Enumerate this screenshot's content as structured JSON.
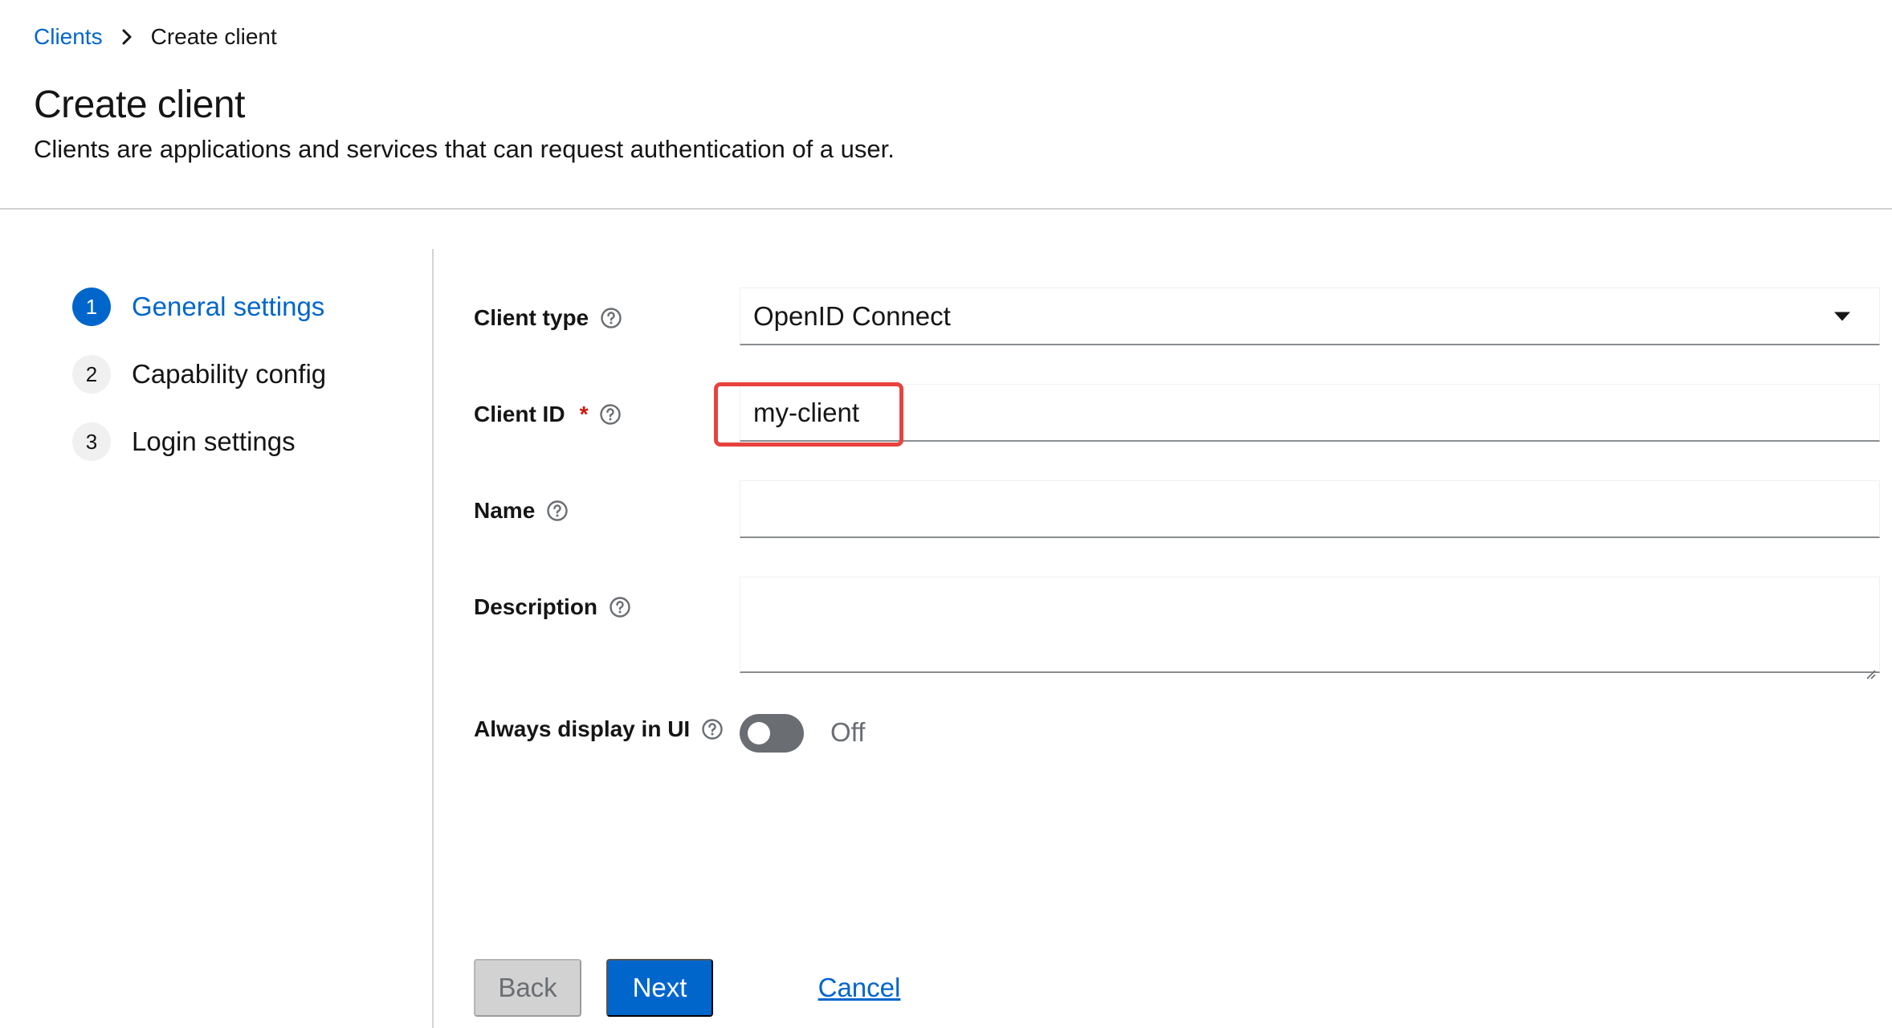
{
  "breadcrumb": {
    "parent": "Clients",
    "current": "Create client"
  },
  "header": {
    "title": "Create client",
    "description": "Clients are applications and services that can request authentication of a user."
  },
  "wizard": {
    "steps": [
      {
        "number": "1",
        "label": "General settings",
        "active": true
      },
      {
        "number": "2",
        "label": "Capability config",
        "active": false
      },
      {
        "number": "3",
        "label": "Login settings",
        "active": false
      }
    ]
  },
  "form": {
    "client_type": {
      "label": "Client type",
      "value": "OpenID Connect"
    },
    "client_id": {
      "label": "Client ID",
      "required_mark": "*",
      "value": "my-client"
    },
    "name": {
      "label": "Name",
      "value": ""
    },
    "description": {
      "label": "Description",
      "value": ""
    },
    "always_display": {
      "label": "Always display in UI",
      "state": "Off"
    }
  },
  "footer": {
    "back_label": "Back",
    "next_label": "Next",
    "cancel_label": "Cancel"
  },
  "colors": {
    "accent": "#0066cc",
    "highlight": "#e8423e",
    "required": "#c9190b"
  }
}
